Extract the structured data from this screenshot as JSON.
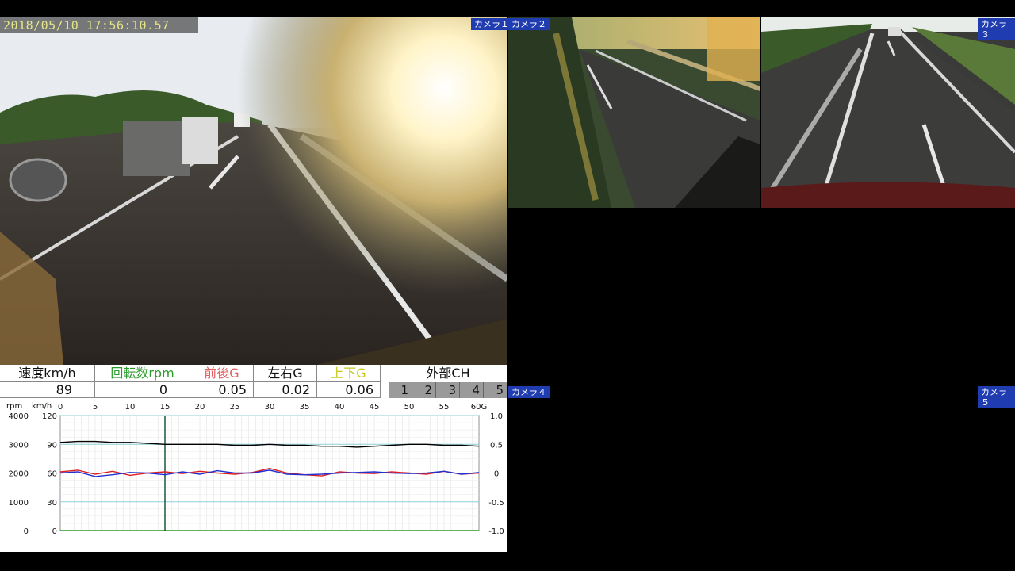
{
  "timestamp": "2018/05/10 17:56:10.57",
  "cameras": {
    "cam1": "カメラ１",
    "cam2": "カメラ２",
    "cam3": "カメラ３",
    "cam4": "カメラ４",
    "cam5": "カメラ５"
  },
  "sensors": {
    "speed": {
      "label": "速度km/h",
      "value": "89",
      "color": "#111111"
    },
    "rpm": {
      "label": "回転数rpm",
      "value": "0",
      "color": "#2a9a2a"
    },
    "fb_g": {
      "label": "前後G",
      "value": "0.05",
      "color": "#e06060"
    },
    "lr_g": {
      "label": "左右G",
      "value": "0.02",
      "color": "#111111"
    },
    "ud_g": {
      "label": "上下G",
      "value": "0.06",
      "color": "#c8c820"
    }
  },
  "external": {
    "title": "外部CH",
    "channels": [
      "1",
      "2",
      "3",
      "4",
      "5"
    ]
  },
  "chart_data": {
    "type": "line",
    "x_ticks": [
      "0",
      "5",
      "10",
      "15",
      "20",
      "25",
      "30",
      "35",
      "40",
      "45",
      "50",
      "55",
      "60"
    ],
    "x_unit": "G",
    "rpm_label": "rpm",
    "kmh_label": "km/h",
    "rpm_ticks": [
      "4000",
      "3000",
      "2000",
      "1000",
      "0"
    ],
    "kmh_ticks": [
      "120",
      "90",
      "60",
      "30",
      "0"
    ],
    "g_ticks": [
      "1.0",
      "0.5",
      "0",
      "-0.5",
      "-1.0"
    ],
    "xlim": [
      0,
      60
    ],
    "cursor_x": 15,
    "series": [
      {
        "color": "#000000",
        "values": [
          92,
          93,
          93,
          92,
          92,
          91,
          90,
          90,
          90,
          90,
          89,
          89,
          90,
          89,
          89,
          88,
          88,
          87,
          88,
          89,
          90,
          90,
          89,
          89,
          88
        ]
      },
      {
        "color": "#e02020",
        "values": [
          0.02,
          0.05,
          -0.02,
          0.03,
          -0.04,
          0.0,
          0.02,
          -0.01,
          0.03,
          0.0,
          -0.02,
          0.01,
          0.08,
          0.0,
          -0.03,
          -0.05,
          0.02,
          0.0,
          -0.01,
          0.02,
          0.0,
          -0.02,
          0.03,
          -0.02,
          0.0
        ]
      },
      {
        "color": "#2030d0",
        "values": [
          0.0,
          0.02,
          -0.06,
          -0.03,
          0.01,
          0.0,
          -0.03,
          0.02,
          -0.02,
          0.04,
          0.0,
          0.0,
          0.05,
          -0.02,
          -0.03,
          -0.02,
          0.0,
          0.01,
          0.02,
          0.0,
          -0.01,
          0.0,
          0.03,
          -0.02,
          0.01
        ]
      }
    ]
  }
}
